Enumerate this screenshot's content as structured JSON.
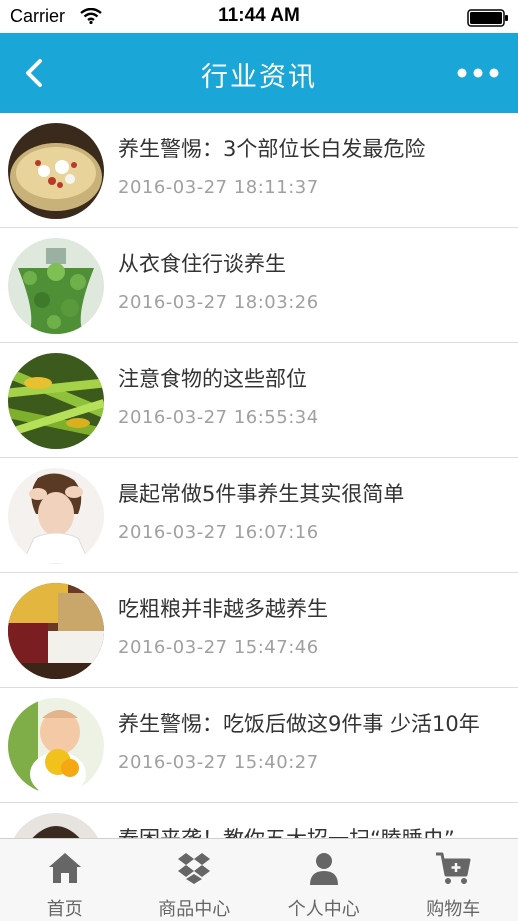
{
  "status": {
    "carrier": "Carrier",
    "time": "11:44 AM"
  },
  "header": {
    "title": "行业资讯"
  },
  "articles": [
    {
      "title": "养生警惕：3个部位长白发最危险",
      "date": "2016-03-27 18:11:37",
      "image": "congee-bowl"
    },
    {
      "title": "从衣食住行谈养生",
      "date": "2016-03-27 18:03:26",
      "image": "hanging-plant"
    },
    {
      "title": "注意食物的这些部位",
      "date": "2016-03-27 16:55:34",
      "image": "green-vegetables"
    },
    {
      "title": "晨起常做5件事养生其实很简单",
      "date": "2016-03-27 16:07:16",
      "image": "woman-headache"
    },
    {
      "title": "吃粗粮并非越多越养生",
      "date": "2016-03-27 15:47:46",
      "image": "grains-beans"
    },
    {
      "title": "养生警惕：吃饭后做这9件事 少活10年",
      "date": "2016-03-27 15:40:27",
      "image": "baby-fruit"
    },
    {
      "title": "春困来袭！教你五大招一扫“瞌睡虫”",
      "date": "",
      "image": "person-head"
    }
  ],
  "tabs": [
    {
      "label": "首页",
      "icon": "home-icon"
    },
    {
      "label": "商品中心",
      "icon": "dropbox-icon"
    },
    {
      "label": "个人中心",
      "icon": "user-icon"
    },
    {
      "label": "购物车",
      "icon": "cart-icon"
    }
  ],
  "colors": {
    "nav": "#1aa6d6",
    "title_text": "#333333",
    "date_text": "#a0a0a0"
  }
}
